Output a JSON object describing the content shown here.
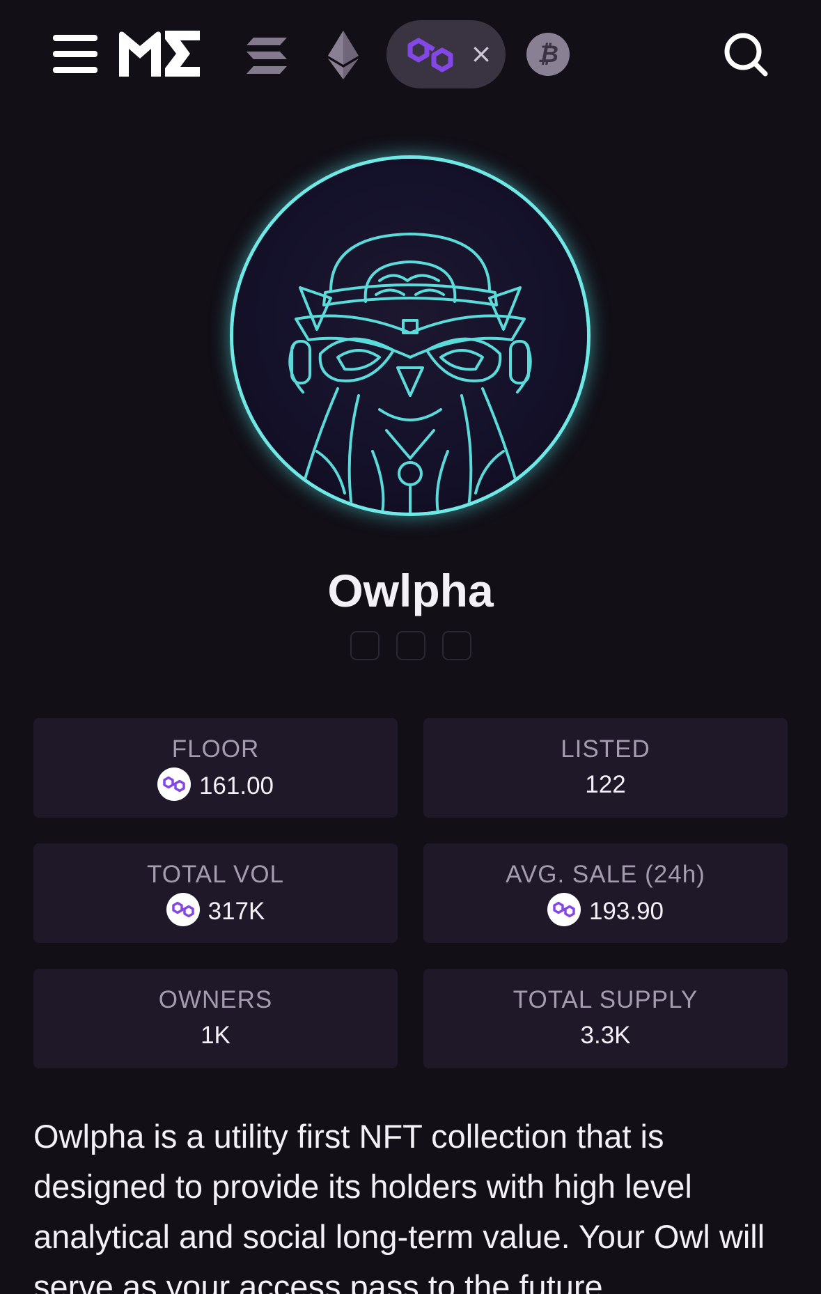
{
  "nav": {
    "menu_icon": "hamburger-menu-icon",
    "logo_icon": "magic-eden-logo-icon",
    "chains": [
      {
        "name": "solana",
        "icon": "solana-icon"
      },
      {
        "name": "ethereum",
        "icon": "ethereum-icon"
      },
      {
        "name": "polygon",
        "icon": "polygon-icon",
        "selected": true,
        "clear_label": "×"
      },
      {
        "name": "bitcoin",
        "icon": "bitcoin-icon",
        "glyph": "₿"
      }
    ],
    "search_icon": "search-icon"
  },
  "collection": {
    "name": "Owlpha",
    "avatar_icon": "owl-avatar-image",
    "social_icons": [
      "social-link-icon",
      "social-link-icon",
      "social-link-icon"
    ]
  },
  "stats": [
    {
      "label": "FLOOR",
      "value": "161.00",
      "currency_icon": "polygon-coin-icon"
    },
    {
      "label": "LISTED",
      "value": "122"
    },
    {
      "label": "TOTAL VOL",
      "value": "317K",
      "currency_icon": "polygon-coin-icon"
    },
    {
      "label": "AVG. SALE (24h)",
      "value": "193.90",
      "currency_icon": "polygon-coin-icon"
    },
    {
      "label": "OWNERS",
      "value": "1K"
    },
    {
      "label": "TOTAL SUPPLY",
      "value": "3.3K"
    }
  ],
  "description": "Owlpha is a utility first NFT collection that is designed to provide its holders with high level analytical and social long-term value. Your Owl will serve as your access pass to the future",
  "colors": {
    "background": "#120f17",
    "card": "#1e1828",
    "accent_purple": "#8247e5",
    "avatar_glow": "#6fe8e6"
  }
}
